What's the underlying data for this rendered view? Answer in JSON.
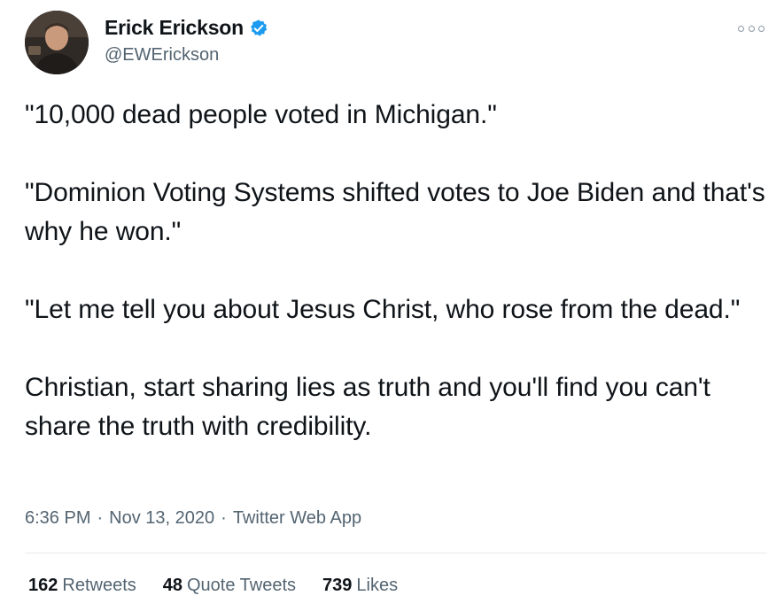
{
  "author": {
    "display_name": "Erick Erickson",
    "handle": "@EWErickson",
    "verified": true,
    "avatar_icon": "profile-photo"
  },
  "more_icon": "more-options-icon",
  "tweet": {
    "paragraphs": [
      "\"10,000 dead people voted in Michigan.\"",
      "\"Dominion Voting Systems shifted votes to Joe Biden and that's why he won.\"",
      "\"Let me tell you about Jesus Christ, who rose from the dead.\"",
      "Christian, start sharing lies as truth and you'll find you can't share the truth with credibility."
    ],
    "time": "6:36 PM",
    "separator": "·",
    "date": "Nov 13, 2020",
    "source": "Twitter Web App"
  },
  "stats": {
    "retweets": {
      "count": "162",
      "label": "Retweets"
    },
    "quote_tweets": {
      "count": "48",
      "label": "Quote Tweets"
    },
    "likes": {
      "count": "739",
      "label": "Likes"
    }
  },
  "colors": {
    "text_primary": "#0f1419",
    "text_secondary": "#536471",
    "verified_blue": "#1d9bf0",
    "divider": "#e6ebef"
  }
}
